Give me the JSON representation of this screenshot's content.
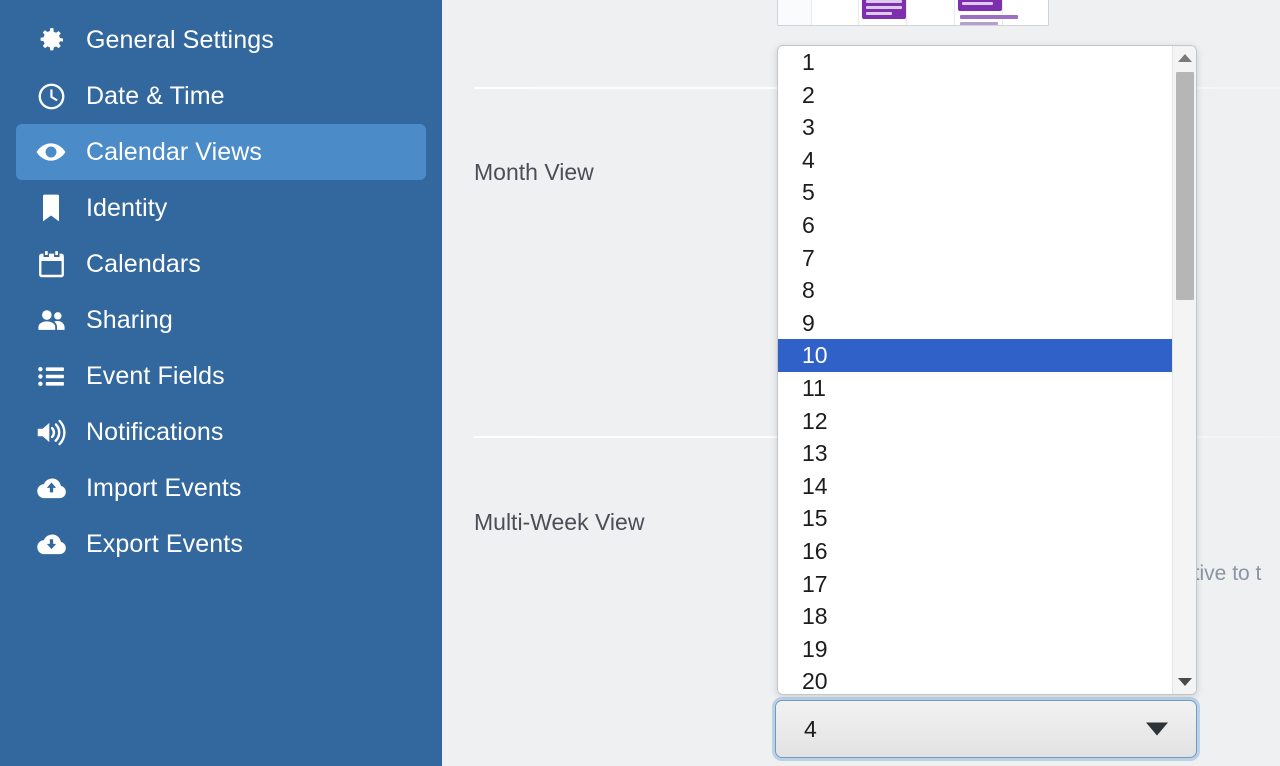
{
  "sidebar": {
    "background_color": "#33689f",
    "active_color": "#4b8bc8",
    "items": [
      {
        "label": "General Settings",
        "icon": "gear-icon",
        "active": false
      },
      {
        "label": "Date & Time",
        "icon": "clock-icon",
        "active": false
      },
      {
        "label": "Calendar Views",
        "icon": "eye-icon",
        "active": true
      },
      {
        "label": "Identity",
        "icon": "bookmark-icon",
        "active": false
      },
      {
        "label": "Calendars",
        "icon": "calendar-icon",
        "active": false
      },
      {
        "label": "Sharing",
        "icon": "people-icon",
        "active": false
      },
      {
        "label": "Event Fields",
        "icon": "list-icon",
        "active": false
      },
      {
        "label": "Notifications",
        "icon": "speaker-icon",
        "active": false
      },
      {
        "label": "Import Events",
        "icon": "cloud-upload-icon",
        "active": false
      },
      {
        "label": "Export Events",
        "icon": "cloud-download-icon",
        "active": false
      }
    ]
  },
  "main": {
    "sections": [
      {
        "label": "Month View"
      },
      {
        "label": "Multi-Week View"
      }
    ],
    "helper_text": "ative to t",
    "preview_tooltip_icon": "magnifier-zoom-icon"
  },
  "dropdown": {
    "selected_value": "10",
    "options": [
      "1",
      "2",
      "3",
      "4",
      "5",
      "6",
      "7",
      "8",
      "9",
      "10",
      "11",
      "12",
      "13",
      "14",
      "15",
      "16",
      "17",
      "18",
      "19",
      "20"
    ],
    "highlight_color": "#2f61c9",
    "scrollbar": {
      "up_icon": "scroll-up-arrow-icon",
      "down_icon": "scroll-down-arrow-icon"
    }
  },
  "select_control": {
    "value": "4",
    "arrow_icon": "chevron-down-icon",
    "focus_ring_color": "#7eaad4"
  }
}
